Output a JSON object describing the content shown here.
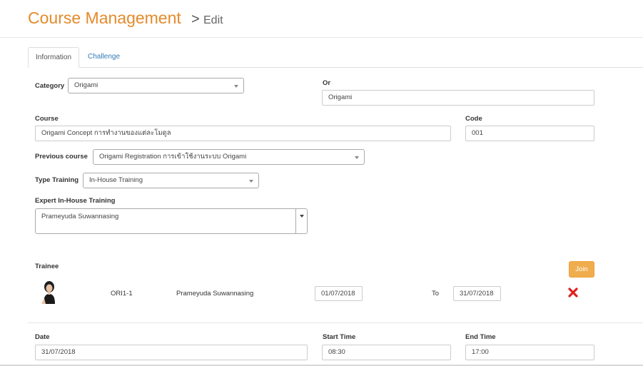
{
  "header": {
    "title": "Course Management",
    "separator": ">",
    "subtitle": "Edit"
  },
  "tabs": [
    {
      "label": "Information",
      "active": true
    },
    {
      "label": "Challenge",
      "active": false
    }
  ],
  "form": {
    "category": {
      "label": "Category",
      "value": "Origami"
    },
    "or": {
      "label": "Or",
      "value": "Origami"
    },
    "course": {
      "label": "Course",
      "value": "Origami Concept การทำงานของแต่ละโมดูล"
    },
    "code": {
      "label": "Code",
      "value": "001"
    },
    "previous_course": {
      "label": "Previous course",
      "value": "Origami Registration การเข้าใช้งานระบบ Origami"
    },
    "type_training": {
      "label": "Type Training",
      "value": "In-House Training"
    },
    "expert": {
      "label": "Expert In-House Training",
      "value": "Prameyuda Suwannasing"
    }
  },
  "trainee": {
    "label": "Trainee",
    "join_label": "Join",
    "rows": [
      {
        "code": "ORI1-1",
        "name": "Prameyuda Suwannasing",
        "from": "01/07/2018",
        "to_label": "To",
        "to": "31/07/2018"
      }
    ]
  },
  "schedule": {
    "date": {
      "label": "Date",
      "value": "31/07/2018"
    },
    "start_time": {
      "label": "Start Time",
      "value": "08:30"
    },
    "end_time": {
      "label": "End Time",
      "value": "17:00"
    }
  },
  "colors": {
    "title": "#e58a2b",
    "join": "#f0ad4e",
    "remove": "#e02020",
    "link": "#337ab7"
  },
  "icons": {
    "remove": "close-x-icon",
    "dropdown": "chevron-down-icon"
  }
}
